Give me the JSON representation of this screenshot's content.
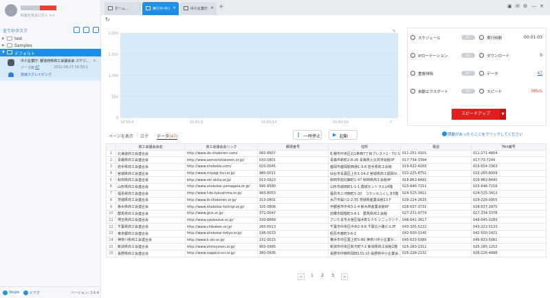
{
  "sidebar": {
    "upgrade_text": "料金を見るに行く >>",
    "task_header": "全てのタスク",
    "folders": [
      {
        "name": "test"
      },
      {
        "name": "Samples"
      },
      {
        "name": "デフォルト"
      }
    ],
    "task": {
      "title": "中小企業庁: 都道府県商工会議会会-スケジ...",
      "data_label": "データ数",
      "data_count": "47",
      "date": "2022-08-27 16:50:1",
      "status": "高速スクレイピング"
    },
    "footer": {
      "skype": "Skype",
      "video": "ビデオ",
      "version": "バージョン: 3.6.4"
    }
  },
  "tabs": [
    {
      "label": "ホーム..."
    },
    {
      "label": "実行中-中小..."
    },
    {
      "label": "中小企業庁..."
    }
  ],
  "chart_data": {
    "type": "area",
    "x_ticks": [
      "16:50:4",
      "16:50:9",
      "16:50:14",
      "16:50:19",
      "0"
    ],
    "y_ticks": [
      "2,000",
      "1,500",
      "1,000",
      "500",
      "0"
    ],
    "ylim": [
      0,
      2000
    ]
  },
  "panel": {
    "schedule": {
      "label": "スケジュール",
      "state": "OFF"
    },
    "ip_rotation": {
      "label": "IPローテーション",
      "state": "OFF"
    },
    "dedupe": {
      "label": "重複排除",
      "state": "OFF"
    },
    "auto_export": {
      "label": "自動エクスポート",
      "state": "OFF"
    },
    "run_time": {
      "label": "実行時間",
      "value": "00:01:03"
    },
    "download": {
      "label": "ダウンロード",
      "value": "0"
    },
    "data": {
      "label": "データ",
      "value": "47"
    },
    "speed": {
      "label": "スピード",
      "value": "0Kb/s"
    },
    "speed_up_button": "スピードアップ"
  },
  "question_link": "問題があったらここをクリックしてください",
  "subtabs": {
    "page": "ページを表示",
    "log": "ログ",
    "data": "データ",
    "data_count": "(47)"
  },
  "actions": {
    "pause": "一時停止",
    "start": "起動"
  },
  "table": {
    "headers": [
      "",
      "商工会議会会名",
      "商工会議会会リンク",
      "郵便番号",
      "住所",
      "電話",
      "FAX番号"
    ],
    "rows": [
      [
        "1",
        "北海道商工会連合会",
        "http://www.do-shokoren.com/",
        "060-8607",
        "札幌市中央区北1条西7丁目プレスト1・7ビル...",
        "011-251-0101",
        "011-271-4804"
      ],
      [
        "2",
        "青森県商工会連合会",
        "http://www.aomorishokoren.or.jp/",
        "030-0801",
        "青森市新町2-8-26 青森県火災共済会館3F",
        "017-734-3394",
        "017-73-7249"
      ],
      [
        "3",
        "岩手県商工会連合会",
        "http://www.shokokai.com/",
        "020-0045",
        "盛岡市盛岡駅西通1-3-8 岩手県商工会館",
        "019-622-4165",
        "019-654-3363"
      ],
      [
        "4",
        "宮城県商工会連合会",
        "http://www.miyagi-fsci.or.jp/",
        "980-0011",
        "仙台市青葉区上杉1-14-2 宮城県商工振興セ...",
        "022-225-8751",
        "022-265-8009"
      ],
      [
        "5",
        "秋田県商工会連合会",
        "http://www.skr-akita.or.jp/",
        "010-0923",
        "秋田市旭北錦町1-47 秋田県商工会館4F",
        "018-863-8491",
        "018-863-8490"
      ],
      [
        "6",
        "山形県商工会連合会",
        "http://www.shokokai-yamagata.or.jp/",
        "990-8580",
        "山形市城南町1-1-1 霞城セントラル14階",
        "023-646-7211",
        "023-646-7216"
      ],
      [
        "7",
        "福島県商工会連合会",
        "http://www.f-do.fukushima.or.jp/",
        "960-8053",
        "福島市三河南町1-20　コラッセふくしま5階",
        "024-525-3411",
        "024-525-3413"
      ],
      [
        "8",
        "茨城県商工会連合会",
        "http://www.ib-shokoren.or.jp/",
        "310-0801",
        "水戸市桜川2-2-35 茨城県産業会館13 F",
        "029-224-2635",
        "029-226-0955"
      ],
      [
        "9",
        "栃木県商工会連合会",
        "http://www.shokokai-tochigi.or.jp/",
        "320-0806",
        "宇都宮市中央3-1-4 栃木県産業会館6F",
        "028-637-3731",
        "028-637-2975"
      ],
      [
        "10",
        "群馬県商工会連合会",
        "http://www.gcis.or.jp/",
        "371-0047",
        "前橋市関根町3-8-1　群馬県商工会館",
        "027-231-9779",
        "027-234-3378"
      ],
      [
        "11",
        "埼玉県商工会連合会",
        "http://www.syokoukai.or.jp/",
        "330-8669",
        "さいたま市大宮区桜木町1-7-5 ソニックシテ...",
        "048-641-3617",
        "048-645-0283"
      ],
      [
        "12",
        "千葉県商工会連合会",
        "http://www.chibaken.or.jp/",
        "260-0013",
        "千葉市中央区中央2-9-8 千葉広小路ビル3F",
        "043-305-5222",
        "043-222-5133"
      ],
      [
        "13",
        "東京都商工会連合会",
        "http://www.shokokai-tokyo.or.jp/",
        "196-0033",
        "昭島市東町3-6-1",
        "042-500-1140",
        "042-500-1421"
      ],
      [
        "14",
        "神奈川県商工会連合会",
        "http://www.k-skr.or.jp/",
        "231-0015",
        "横浜市中区尾上町5-80 神奈川中小企業セ...",
        "045-633-5080",
        "045-633-5081"
      ],
      [
        "15",
        "新潟県商工会連合会",
        "http://www.shinsyoren.or.jp/",
        "950-0965",
        "新潟市中央区新光町7-2 新潟県商工会館2階",
        "025-283-1311",
        "025-285-1252"
      ],
      [
        "16",
        "長野県商工会連合会",
        "http://www.nagano-sci.or.jp/",
        "380-0936",
        "長野市中御所岡田131-10 長野県中小企業会...",
        "026-228-2131",
        "026-226-4998"
      ]
    ]
  },
  "pagination": {
    "prev": "<",
    "pages": [
      "1",
      "2",
      "3"
    ],
    "next": ">"
  }
}
